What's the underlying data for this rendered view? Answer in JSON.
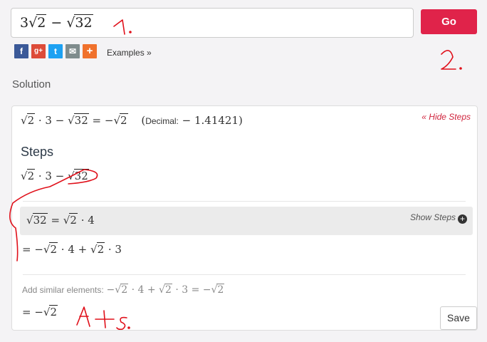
{
  "input": {
    "coef": "3",
    "rad1": "2",
    "op": "−",
    "rad2": "32"
  },
  "go_label": "Go",
  "share": {
    "facebook": "f",
    "googleplus": "g+",
    "twitter": "t",
    "email": "✉",
    "more": "+"
  },
  "examples_label": "Examples »",
  "solution_label": "Solution",
  "result": {
    "rad": "2",
    "mid": "· 3 −",
    "rad2": "32",
    "eq": "= −",
    "rad3": "2",
    "decimal_label": "Decimal:",
    "decimal_value": "− 1.41421"
  },
  "hide_steps": "« Hide Steps",
  "steps_title": "Steps",
  "step_expr": {
    "rad1": "2",
    "mid": "· 3 −",
    "rad2": "32"
  },
  "gray_step": {
    "rad1": "32",
    "eq": "=",
    "rad2": "2",
    "tail": "· 4"
  },
  "show_steps": "Show Steps",
  "step2": {
    "pre": "= −",
    "rad1": "2",
    "mid": "· 4 +",
    "rad2": "2",
    "tail": "· 3"
  },
  "add_similar": {
    "label": "Add similar elements:",
    "pre": "−",
    "rad1": "2",
    "mid": "· 4 +",
    "rad2": "2",
    "mid2": "· 3 = −",
    "rad3": "2"
  },
  "final": {
    "pre": "= −",
    "rad": "2"
  },
  "save_label": "Save",
  "annotations": {
    "one": "1.",
    "two": "2.",
    "ats": "A+s."
  },
  "colors": {
    "accent": "#e0234a",
    "annotation": "#e0101a"
  }
}
